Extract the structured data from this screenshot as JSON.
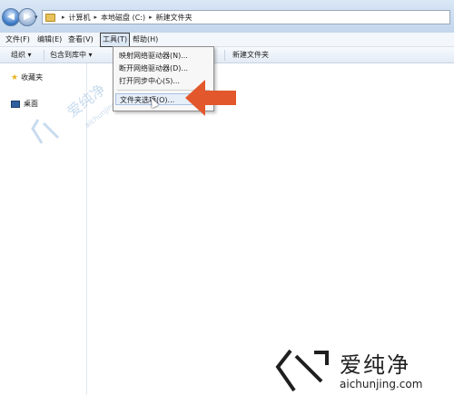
{
  "address": {
    "crumbs": [
      "计算机",
      "本地磁盘 (C:)",
      "新建文件夹"
    ]
  },
  "menubar": {
    "items": [
      "文件(F)",
      "编辑(E)",
      "查看(V)",
      "工具(T)",
      "帮助(H)"
    ],
    "active": "工具(T)"
  },
  "toolbar": {
    "organize": "组织 ▾",
    "include_library": "包含到库中 ▾",
    "new_folder": "新建文件夹"
  },
  "sidebar": {
    "favorites": "收藏夹",
    "desktop": "桌面"
  },
  "tools_menu": {
    "items": [
      "映射网络驱动器(N)...",
      "断开网络驱动器(D)...",
      "打开同步中心(S)...",
      "文件夹选项(O)..."
    ],
    "highlighted_index": 3
  },
  "watermark": {
    "brand": "爱纯净",
    "url": "aichunjing.com"
  },
  "colors": {
    "arrow": "#e2572b",
    "title_bar": "#cfe0f3"
  }
}
